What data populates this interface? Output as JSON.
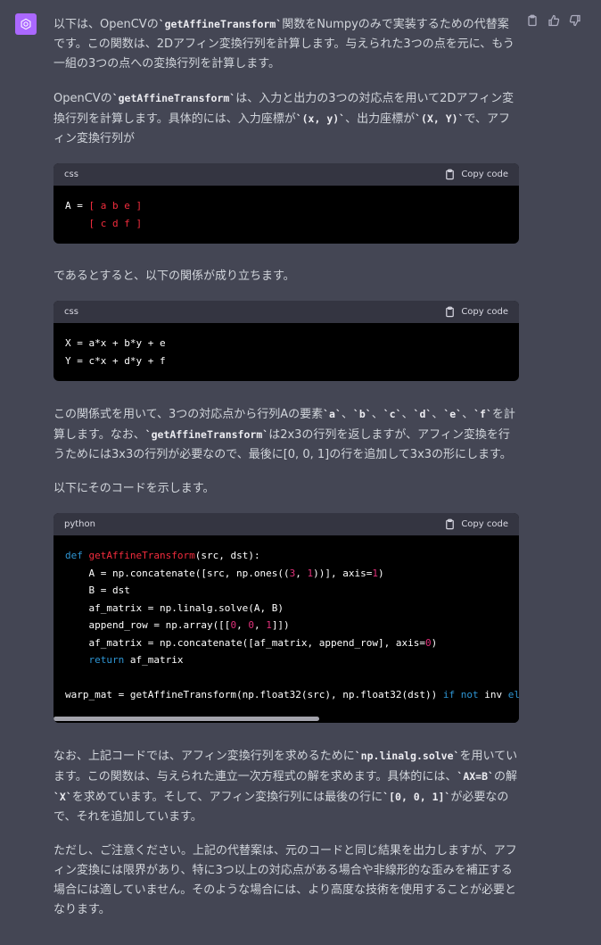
{
  "message": {
    "p1_a": "以下は、OpenCVの",
    "p1_code": "`getAffineTransform`",
    "p1_b": "関数をNumpyのみで実装するための代替案です。この関数は、2Dアフィン変換行列を計算します。与えられた3つの点を元に、もう一組の3つの点への変換行列を計算します。",
    "p2_a": "OpenCVの",
    "p2_code1": "`getAffineTransform`",
    "p2_b": "は、入力と出力の3つの対応点を用いて2Dアフィン変換行列を計算します。具体的には、入力座標が",
    "p2_code2": "`(x, y)`",
    "p2_c": "、出力座標が",
    "p2_code3": "`(X, Y)`",
    "p2_d": "で、アフィン変換行列が",
    "p3": "であるとすると、以下の関係が成り立ちます。",
    "p4_a": "この関係式を用いて、3つの対応点から行列Aの要素",
    "p4_codes": [
      "`a`",
      "`b`",
      "`c`",
      "`d`",
      "`e`",
      "`f`"
    ],
    "p4_b": "を計算します。なお、",
    "p4_code": "`getAffineTransform`",
    "p4_c": "は2x3の行列を返しますが、アフィン変換を行うためには3x3の行列が必要なので、最後に[0, 0, 1]の行を追加して3x3の形にします。",
    "p5": "以下にそのコードを示します。",
    "p6_a": "なお、上記コードでは、アフィン変換行列を求めるために",
    "p6_code1": "`np.linalg.solve`",
    "p6_b": "を用いています。この関数は、与えられた連立一次方程式の解を求めます。具体的には、",
    "p6_code2": "`AX=B`",
    "p6_c": "の解",
    "p6_code3": "`X`",
    "p6_d": "を求めています。そして、アフィン変換行列には最後の行に",
    "p6_code4": "`[0, 0, 1]`",
    "p6_e": "が必要なので、それを追加しています。",
    "p7": "ただし、ご注意ください。上記の代替案は、元のコードと同じ結果を出力しますが、アフィン変換には限界があり、特に3つ以上の対応点がある場合や非線形的な歪みを補正する場合には適していません。そのような場合には、より高度な技術を使用することが必要となります。"
  },
  "code_blocks": [
    {
      "lang": "css",
      "copy_label": "Copy code"
    },
    {
      "lang": "css",
      "copy_label": "Copy code"
    },
    {
      "lang": "python",
      "copy_label": "Copy code"
    }
  ],
  "code1": {
    "l1_a": "A = ",
    "l1_b": "[ a b e ]",
    "l2_b": "[ c d f ]"
  },
  "code2": {
    "l1": "X = a*x + b*y + e",
    "l2": "Y = c*x + d*y + f"
  },
  "code3": {
    "def": "def",
    "fname": "getAffineTransform",
    "sig": "(src, dst):",
    "l2a": "    A = np.concatenate([src, np.ones((",
    "l2n1": "3",
    "l2m": ", ",
    "l2n2": "1",
    "l2b": "))], axis=",
    "l2n3": "1",
    "l2c": ")",
    "l3": "    B = dst",
    "l4": "    af_matrix = np.linalg.solve(A, B)",
    "l5a": "    append_row = np.array([[",
    "l5n1": "0",
    "l5m1": ", ",
    "l5n2": "0",
    "l5m2": ", ",
    "l5n3": "1",
    "l5b": "]])",
    "l6a": "    af_matrix = np.concatenate([af_matrix, append_row], axis=",
    "l6n": "0",
    "l6b": ")",
    "l7kw": "return",
    "l7": " af_matrix",
    "l9a": "warp_mat = getAffineTransform(np.float32(src), np.float32(dst)) ",
    "l9kw1": "if",
    "l9sp": " ",
    "l9kw2": "not",
    "l9b": " inv ",
    "l9kw3": "else"
  },
  "colors": {
    "background": "#444654",
    "avatar": "#ab68ff",
    "code_bg": "#000000",
    "keyword": "#2e95d3",
    "function": "#f22c3d",
    "number": "#df3079"
  },
  "icons": [
    "openai-logo-icon",
    "clipboard-icon",
    "thumbs-up-icon",
    "thumbs-down-icon"
  ]
}
